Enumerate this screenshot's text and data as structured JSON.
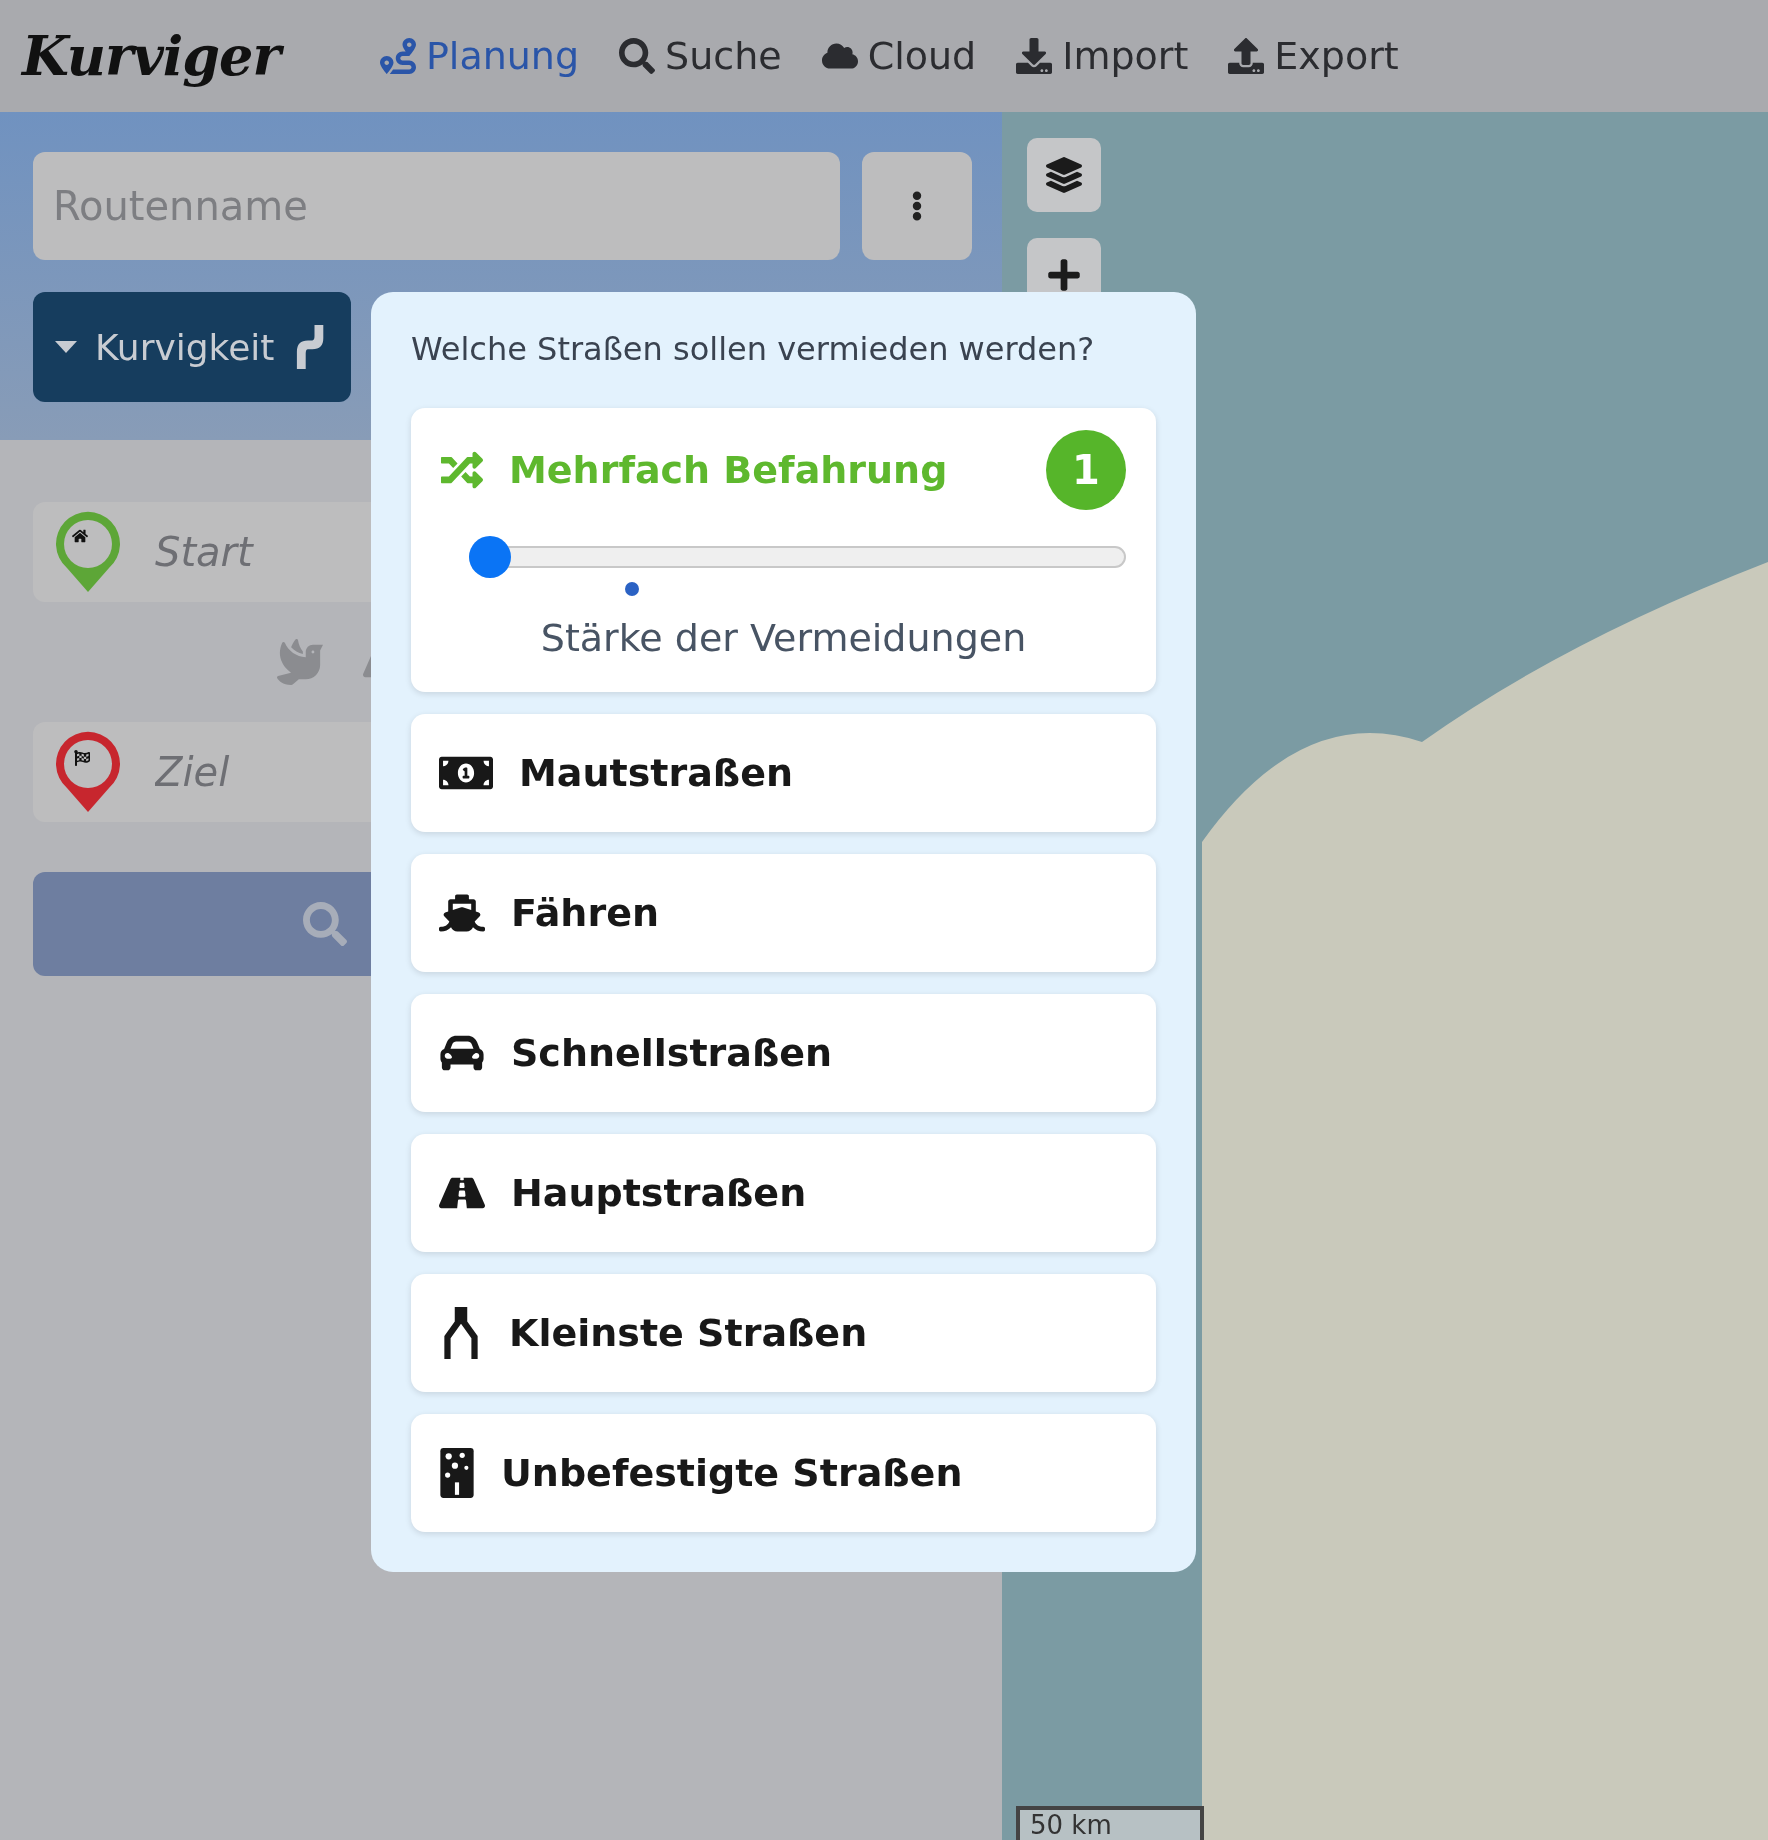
{
  "header": {
    "logo": "Kurviger",
    "nav": [
      {
        "label": "Planung",
        "selected": true
      },
      {
        "label": "Suche",
        "selected": false
      },
      {
        "label": "Cloud",
        "selected": false
      },
      {
        "label": "Import",
        "selected": false
      },
      {
        "label": "Export",
        "selected": false
      }
    ]
  },
  "route_panel": {
    "name_field": {
      "placeholder": "Routenname"
    },
    "profile_button": {
      "label": "Kurvigkeit"
    },
    "waypoints": [
      {
        "kind": "start",
        "placeholder": "Start"
      },
      {
        "kind": "end",
        "placeholder": "Ziel"
      }
    ]
  },
  "map": {
    "scale": "50 km"
  },
  "avoid_popup": {
    "question": "Welche Straßen sollen vermieden werden?",
    "multi_pass": {
      "label": "Mehrfach Befahrung",
      "count": "1",
      "level": 0,
      "caption": "Stärke der Vermeidungen"
    },
    "options": [
      {
        "kind": "toll",
        "label": "Mautstraßen"
      },
      {
        "kind": "ferry",
        "label": "Fähren"
      },
      {
        "kind": "motorway",
        "label": "Schnellstraßen"
      },
      {
        "kind": "main",
        "label": "Hauptstraßen"
      },
      {
        "kind": "small",
        "label": "Kleinste Straßen"
      },
      {
        "kind": "unpaved",
        "label": "Unbefestigte Straßen"
      }
    ]
  }
}
